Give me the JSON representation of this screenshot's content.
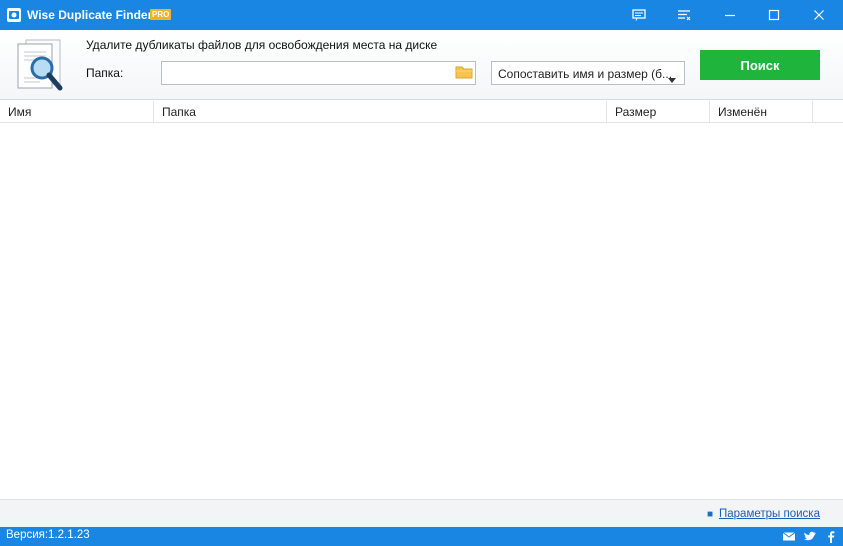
{
  "window": {
    "title": "Wise Duplicate Finder",
    "badge": "PRO",
    "controls": [
      "feedback-icon",
      "menu-icon",
      "minimize-icon",
      "maximize-icon",
      "close-icon"
    ]
  },
  "header": {
    "subtitle": "Удалите дубликаты файлов для освобождения места на диске",
    "folder_label": "Папка:",
    "folder_value": "",
    "match_mode": "Сопоставить имя и размер (б...",
    "search_label": "Поиск"
  },
  "table": {
    "columns": [
      "Имя",
      "Папка",
      "Размер",
      "Изменён"
    ],
    "rows": []
  },
  "footer": {
    "search_params_link": "Параметры поиска"
  },
  "status": {
    "version": "Версия:1.2.1.23",
    "social": [
      "email-icon",
      "twitter-icon",
      "facebook-icon"
    ]
  },
  "colors": {
    "titlebar": "#1a86e3",
    "search_button": "#1fb53c",
    "pro_badge": "#f0b323",
    "link": "#1a5fb4"
  }
}
